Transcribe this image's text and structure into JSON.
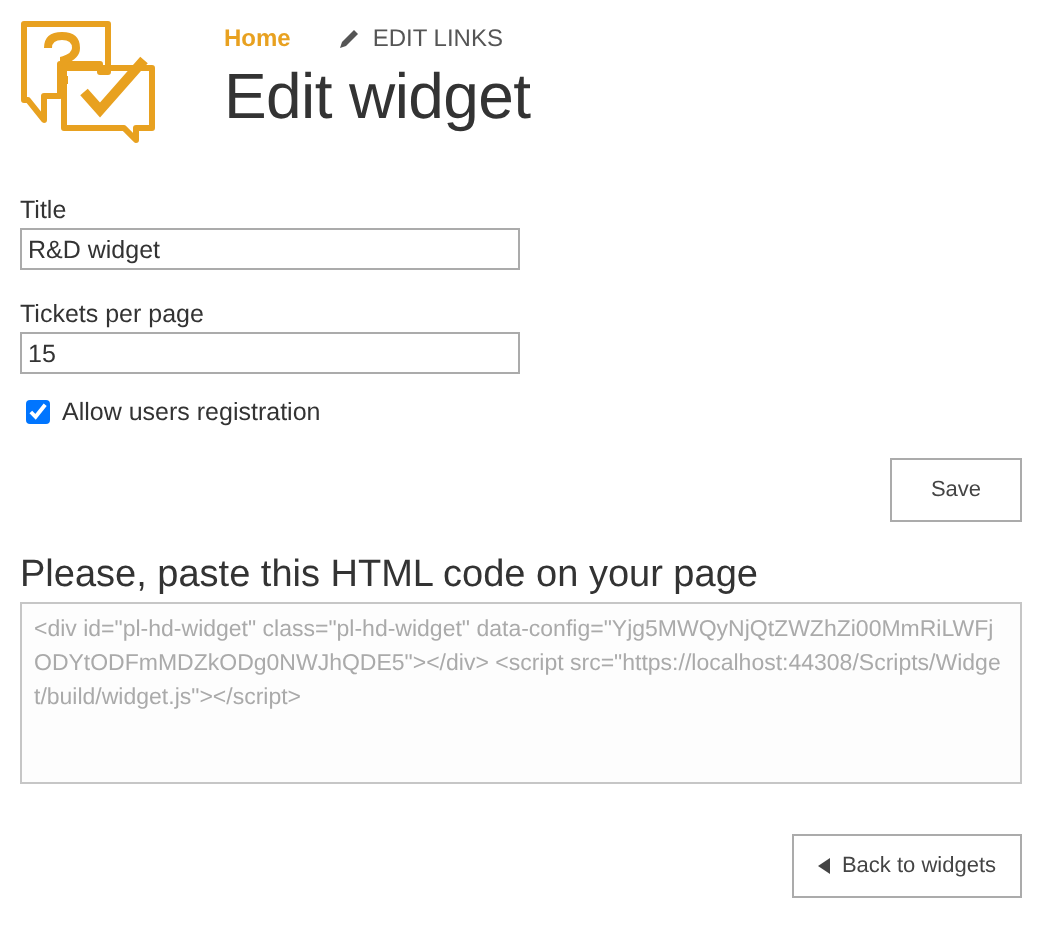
{
  "nav": {
    "home": "Home",
    "edit_links": "EDIT LINKS"
  },
  "page_title": "Edit widget",
  "form": {
    "title": {
      "label": "Title",
      "value": "R&D widget"
    },
    "tickets": {
      "label": "Tickets per page",
      "value": "15"
    },
    "allow_registration": {
      "label": "Allow users registration",
      "checked": true
    },
    "save": "Save"
  },
  "embed": {
    "heading": "Please, paste this HTML code on your page",
    "code": "<div id=\"pl-hd-widget\" class=\"pl-hd-widget\" data-config=\"Yjg5MWQyNjQtZWZhZi00MmRiLWFjODYtODFmMDZkODg0NWJhQDE5\"></div> <script src=\"https://localhost:44308/Scripts/Widget/build/widget.js\"></script>"
  },
  "back": "Back to widgets"
}
